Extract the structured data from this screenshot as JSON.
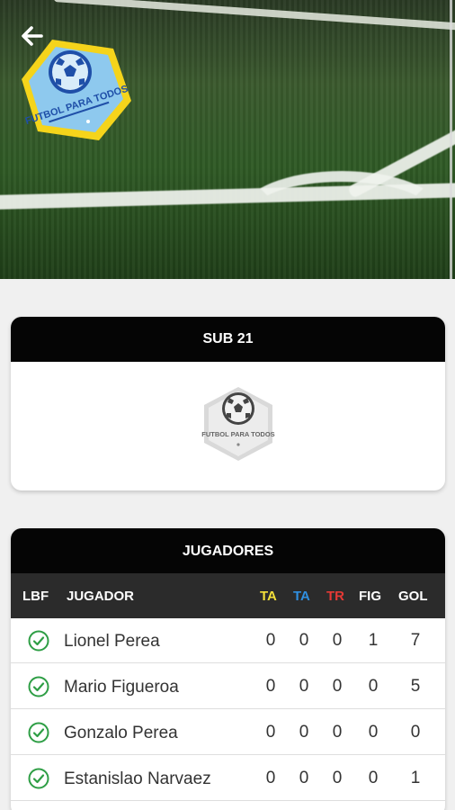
{
  "header": {
    "back_icon": "arrow-left-icon",
    "logo_text": "FUTBOL PARA TODOS"
  },
  "team_card": {
    "title": "SUB 21",
    "logo_text": "FUTBOL PARA TODOS"
  },
  "players_card": {
    "title": "JUGADORES",
    "columns": {
      "lbf": "LBF",
      "player": "JUGADOR",
      "ta_yellow": "TA",
      "ta_blue": "TA",
      "tr": "TR",
      "fig": "FIG",
      "gol": "GOL"
    },
    "column_colors": {
      "ta_yellow": "#f4e03a",
      "ta_blue": "#2f8fe0",
      "tr": "#e53935"
    },
    "rows": [
      {
        "name": "Lionel Perea",
        "ta_yellow": "0",
        "ta_blue": "0",
        "tr": "0",
        "fig": "1",
        "gol": "7"
      },
      {
        "name": "Mario Figueroa",
        "ta_yellow": "0",
        "ta_blue": "0",
        "tr": "0",
        "fig": "0",
        "gol": "5"
      },
      {
        "name": "Gonzalo Perea",
        "ta_yellow": "0",
        "ta_blue": "0",
        "tr": "0",
        "fig": "0",
        "gol": "0"
      },
      {
        "name": "Estanislao Narvaez",
        "ta_yellow": "0",
        "ta_blue": "0",
        "tr": "0",
        "fig": "0",
        "gol": "1"
      }
    ]
  },
  "colors": {
    "header_black": "#050505",
    "subheader_gray": "#2b2b2b",
    "check_green": "#2e9e45",
    "logo_blue": "#6fb7e6",
    "logo_yellow": "#f5d41b"
  }
}
